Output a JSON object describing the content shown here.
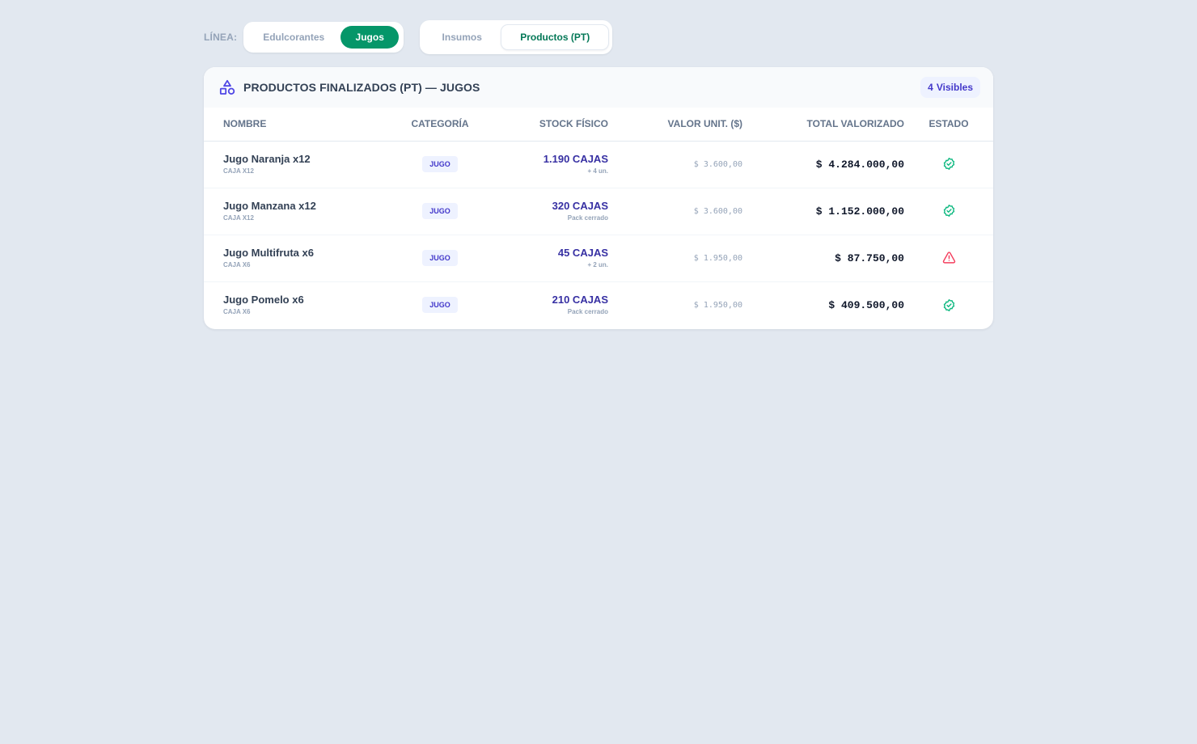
{
  "filters": {
    "line_label": "LÍNEA:",
    "line_options": [
      {
        "label": "Edulcorantes",
        "active": false
      },
      {
        "label": "Jugos",
        "active": true
      }
    ],
    "view_options": [
      {
        "label": "Insumos",
        "active": false
      },
      {
        "label": "Productos (PT)",
        "active": true
      }
    ]
  },
  "card": {
    "title": "PRODUCTOS FINALIZADOS (PT) — JUGOS",
    "icon": "shapes-icon",
    "visible_count": "4",
    "visible_label": "Visibles"
  },
  "table": {
    "columns": [
      "NOMBRE",
      "CATEGORÍA",
      "STOCK FÍSICO",
      "VALOR UNIT. ($)",
      "TOTAL VALORIZADO",
      "ESTADO"
    ],
    "rows": [
      {
        "name": "Jugo Naranja x12",
        "pack": "CAJA X12",
        "category": "JUGO",
        "stock": "1.190 CAJAS",
        "stock_sub": "+ 4 un.",
        "unit_value": "$ 3.600,00",
        "total": "$ 4.284.000,00",
        "status": "ok",
        "status_icon": "check-badge-icon"
      },
      {
        "name": "Jugo Manzana x12",
        "pack": "CAJA X12",
        "category": "JUGO",
        "stock": "320 CAJAS",
        "stock_sub": "Pack cerrado",
        "unit_value": "$ 3.600,00",
        "total": "$ 1.152.000,00",
        "status": "ok",
        "status_icon": "check-badge-icon"
      },
      {
        "name": "Jugo Multifruta x6",
        "pack": "CAJA X6",
        "category": "JUGO",
        "stock": "45 CAJAS",
        "stock_sub": "+ 2 un.",
        "unit_value": "$ 1.950,00",
        "total": "$ 87.750,00",
        "status": "warning",
        "status_icon": "warning-triangle-icon"
      },
      {
        "name": "Jugo Pomelo x6",
        "pack": "CAJA X6",
        "category": "JUGO",
        "stock": "210 CAJAS",
        "stock_sub": "Pack cerrado",
        "unit_value": "$ 1.950,00",
        "total": "$ 409.500,00",
        "status": "ok",
        "status_icon": "check-badge-icon"
      }
    ]
  },
  "colors": {
    "accent_green": "#059669",
    "accent_indigo": "#4338ca",
    "status_ok": "#10b981",
    "status_warning": "#f43f5e",
    "background": "#e2e8f0"
  }
}
